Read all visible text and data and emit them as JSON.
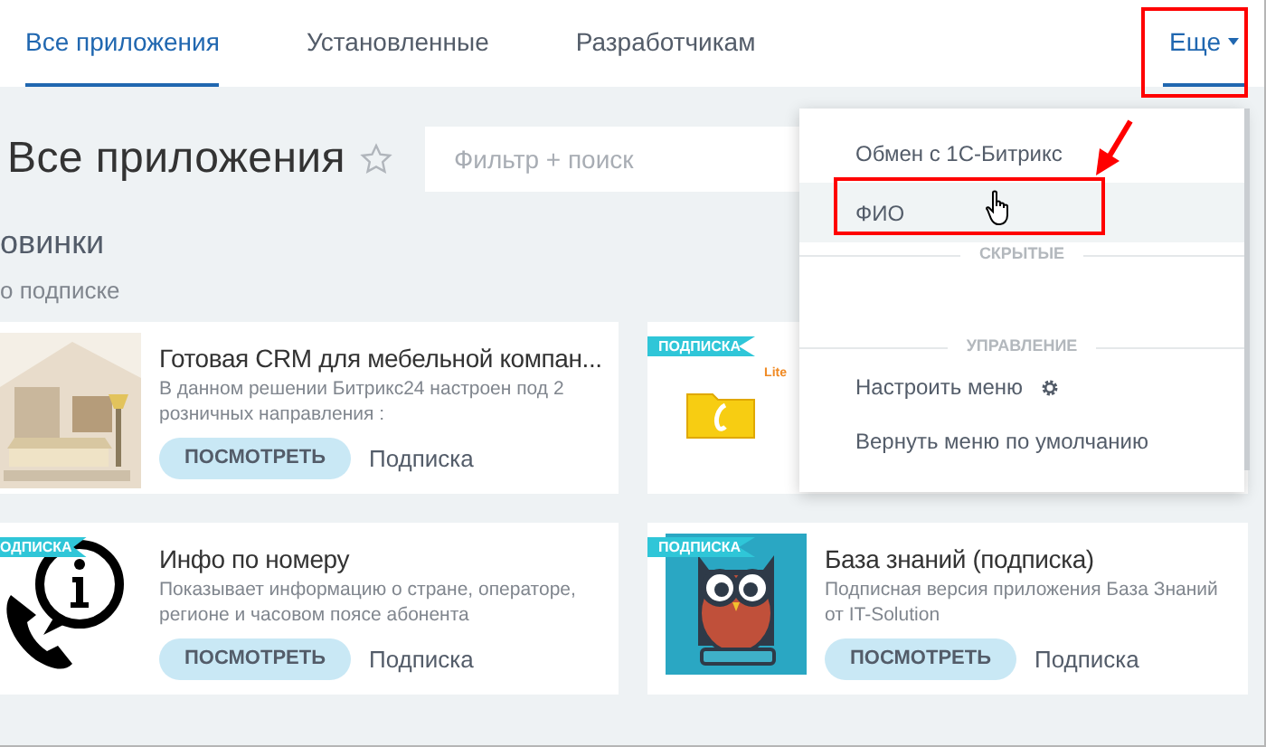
{
  "tabs": [
    {
      "label": "Все приложения",
      "selected": true
    },
    {
      "label": "Установленные",
      "selected": false
    },
    {
      "label": "Разработчикам",
      "selected": false
    }
  ],
  "more_tab": {
    "label": "Еще",
    "expanded": true
  },
  "page_title": "Все приложения",
  "search": {
    "placeholder": "Фильтр + поиск"
  },
  "section": {
    "title": "овинки",
    "subtitle": "о подписке"
  },
  "apps": [
    {
      "kind": "picture",
      "title": "Готовая CRM для мебельной компан...",
      "description": "В данном решении Битрикс24 настроен под 2 розничных направления :",
      "button": "ПОСМОТРЕТЬ",
      "price": "Подписка"
    },
    {
      "kind": "folder",
      "badge": "ПОДПИСКА",
      "icon_label": "Lite"
    },
    {
      "kind": "phone-info",
      "badge": "ОДПИСКА",
      "title": "Инфо по номеру",
      "description": "Показывает информацию о стране, операторе, регионе и часовом поясе абонента",
      "button": "ПОСМОТРЕТЬ",
      "price": "Подписка"
    },
    {
      "kind": "owl",
      "badge": "ПОДПИСКА",
      "title": "База знаний (подписка)",
      "description": "Подписная версия приложения База Знаний от IT-Solution",
      "button": "ПОСМОТРЕТЬ",
      "price": "Подписка"
    }
  ],
  "menu": {
    "items": [
      {
        "kind": "item",
        "label": "Обмен с 1С-Битрикс",
        "selected": false
      },
      {
        "kind": "item",
        "label": "ФИО",
        "selected": true
      },
      {
        "kind": "header",
        "label": "СКРЫТЫЕ"
      },
      {
        "kind": "spacer"
      },
      {
        "kind": "header",
        "label": "УПРАВЛЕНИЕ"
      },
      {
        "kind": "gear",
        "label": "Настроить меню"
      },
      {
        "kind": "item",
        "label": "Вернуть меню по умолчанию",
        "selected": false
      }
    ]
  }
}
